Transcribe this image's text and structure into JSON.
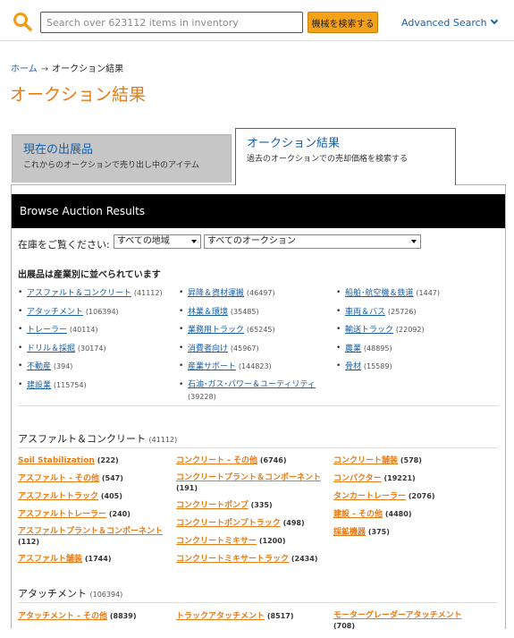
{
  "search": {
    "placeholder": "Search over 623112 items in inventory",
    "button_label": "機械を検索する",
    "advanced_label": "Advanced Search"
  },
  "breadcrumb": {
    "home": "ホーム",
    "separator": "→",
    "current": "オークション結果"
  },
  "page_title": "オークション結果",
  "tabs": [
    {
      "title": "現在の出展品",
      "subtitle": "これからのオークションで売り出し中のアイテム"
    },
    {
      "title": "オークション結果",
      "subtitle": "過去のオークションでの売却価格を検索する"
    }
  ],
  "panel": {
    "header": "Browse Auction Results",
    "filter_label": "在庫をご覧ください:",
    "region_value": "すべての地域",
    "auction_value": "すべてのオークション"
  },
  "industries_heading": "出展品は産業別に並べられています",
  "industries": {
    "col1": [
      {
        "label": "アスファルト＆コンクリート",
        "count": "(41112)"
      },
      {
        "label": "アタッチメント",
        "count": "(106394)"
      },
      {
        "label": "トレーラー",
        "count": "(40114)"
      },
      {
        "label": "ドリル＆採掘",
        "count": "(30174)"
      },
      {
        "label": "不動産",
        "count": "(394)"
      },
      {
        "label": "建設業",
        "count": "(115754)"
      }
    ],
    "col2": [
      {
        "label": "昇降＆資材運搬",
        "count": "(46497)"
      },
      {
        "label": "林業＆環境",
        "count": "(35485)"
      },
      {
        "label": "業務用トラック",
        "count": "(65245)"
      },
      {
        "label": "消費者向け",
        "count": "(45967)"
      },
      {
        "label": "産業サポート",
        "count": "(144823)"
      },
      {
        "label": "石油･ガス･パワー＆ユーティリティ",
        "count": "(39228)"
      }
    ],
    "col3": [
      {
        "label": "船舶･航空機＆鉄道",
        "count": "(1447)"
      },
      {
        "label": "車両＆バス",
        "count": "(25726)"
      },
      {
        "label": "輸送トラック",
        "count": "(22092)"
      },
      {
        "label": "農業",
        "count": "(48895)"
      },
      {
        "label": "骨材",
        "count": "(15589)"
      }
    ]
  },
  "sections": [
    {
      "title": "アスファルト＆コンクリート",
      "count": "(41112)",
      "col1": [
        {
          "label": "Soil Stabilization",
          "count": "(222)"
        },
        {
          "label": "アスファルト - その他",
          "count": "(547)"
        },
        {
          "label": "アスファルトトラック",
          "count": "(405)"
        },
        {
          "label": "アスファルトトレーラー",
          "count": "(240)"
        },
        {
          "label": "アスファルトプラント＆コンポーネント",
          "count": "(112)"
        },
        {
          "label": "アスファルト舗装",
          "count": "(1744)"
        }
      ],
      "col2": [
        {
          "label": "コンクリート - その他",
          "count": "(6746)"
        },
        {
          "label": "コンクリートプラント＆コンポーネント",
          "count": "(191)"
        },
        {
          "label": "コンクリートポンプ",
          "count": "(335)"
        },
        {
          "label": "コンクリートポンプトラック",
          "count": "(498)"
        },
        {
          "label": "コンクリートミキサー",
          "count": "(1200)"
        },
        {
          "label": "コンクリートミキサートラック",
          "count": "(2434)"
        }
      ],
      "col3": [
        {
          "label": "コンクリート舗装",
          "count": "(578)"
        },
        {
          "label": "コンパクター",
          "count": "(19221)"
        },
        {
          "label": "タンカートレーラー",
          "count": "(2076)"
        },
        {
          "label": "建設 - その他",
          "count": "(4480)"
        },
        {
          "label": "採鉱機器",
          "count": "(375)"
        }
      ]
    },
    {
      "title": "アタッチメント",
      "count": "(106394)",
      "col1": [
        {
          "label": "アタッチメント - その他",
          "count": "(8839)"
        }
      ],
      "col2": [
        {
          "label": "トラックアタッチメント",
          "count": "(8517)"
        }
      ],
      "col3": [
        {
          "label": "モーターグレーダーアタッチメント",
          "count": "(708)"
        }
      ]
    }
  ]
}
